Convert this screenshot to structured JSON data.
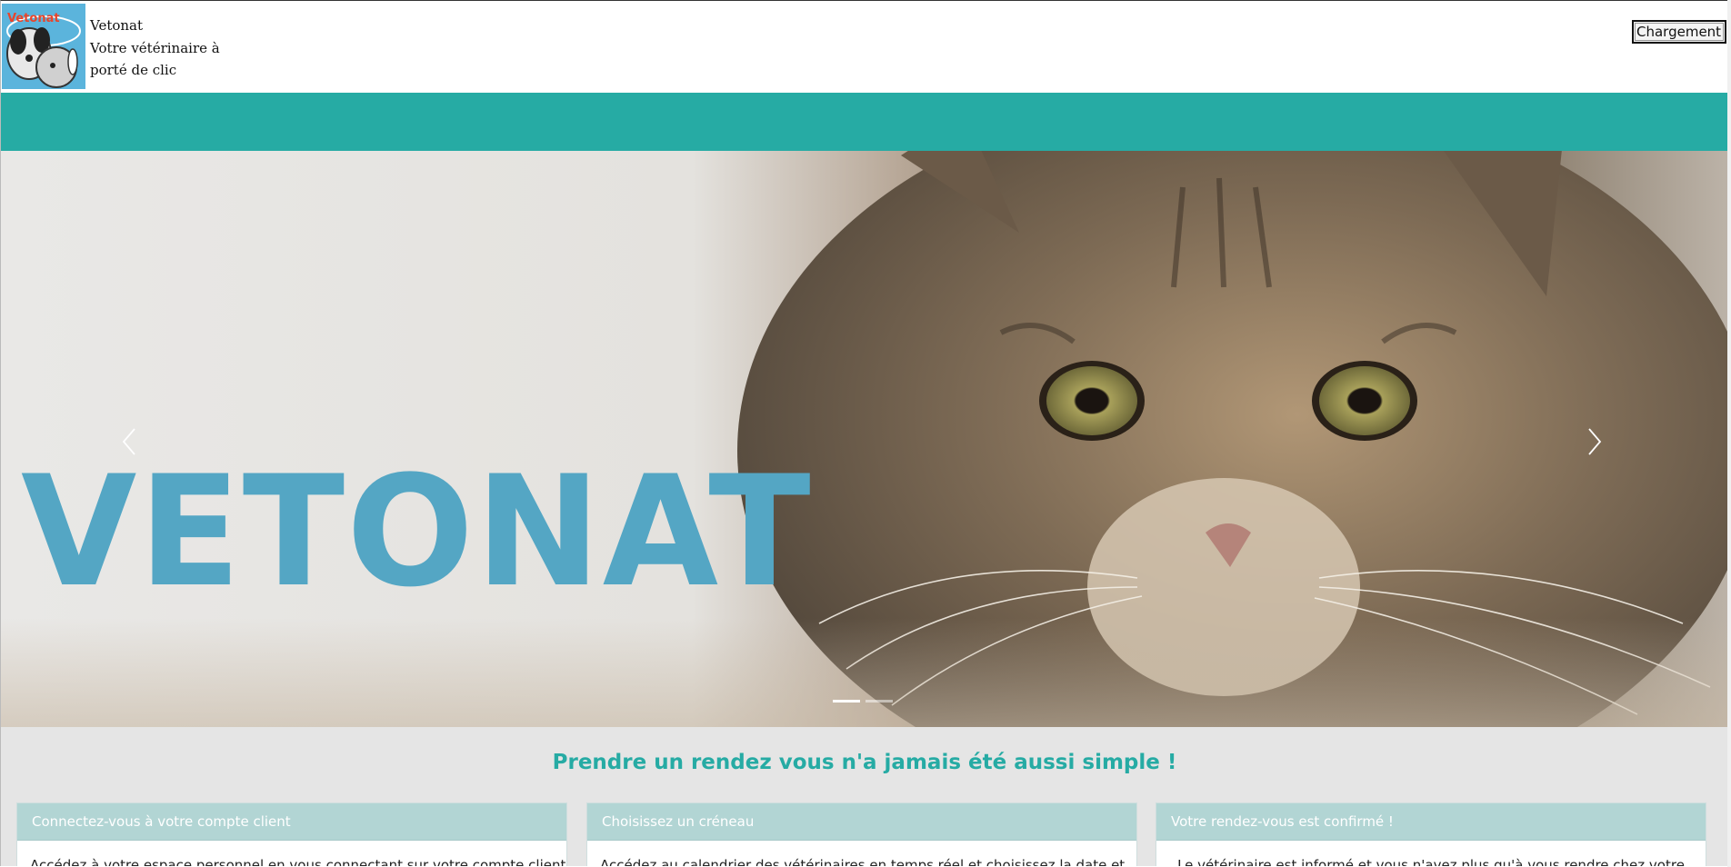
{
  "header": {
    "logo_alt": "Vetonat",
    "brand_lines": [
      "Vetonat",
      "Votre vétérinaire à",
      "porté de clic"
    ],
    "loading_button": "Chargement ..."
  },
  "hero": {
    "title": "VETONAT",
    "prev_icon": "chevron-left-icon",
    "next_icon": "chevron-right-icon",
    "slides_total": 2,
    "active_slide": 1
  },
  "main": {
    "tagline": "Prendre un rendez vous n'a jamais été aussi simple !",
    "cards": [
      {
        "title": "Connectez-vous à votre compte client",
        "text": "Accédez à votre espace personnel en vous connectant sur votre compte client"
      },
      {
        "title": "Choisissez un créneau",
        "text": "Accédez au calendrier des vétérinaires en temps réel et choisissez la date et"
      },
      {
        "title": "Votre rendez-vous est confirmé !",
        "text": "Le vétérinaire est informé et vous n'avez plus qu'à vous rendre chez votre"
      }
    ]
  },
  "colors": {
    "accent": "#26aba4",
    "hero_title": "#54a6c4",
    "card_header": "#b2d5d4",
    "logo_bg": "#5bb4dc",
    "logo_text": "#e8452b"
  }
}
